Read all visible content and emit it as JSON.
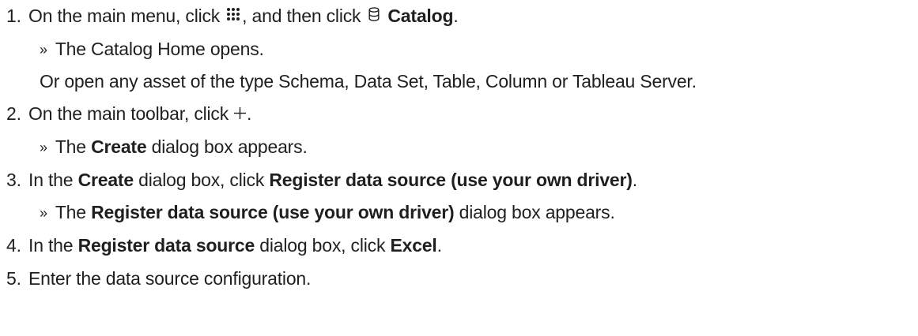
{
  "steps": [
    {
      "number": "1.",
      "text_before_grid": "On the main menu, click",
      "text_after_grid": ", and then click",
      "catalog_label": "Catalog",
      "text_end": ".",
      "result": "The Catalog Home opens.",
      "alternative": "Or open any asset of the type Schema, Data Set, Table, Column or Tableau Server."
    },
    {
      "number": "2.",
      "text_before_plus": "On the main toolbar, click",
      "text_end": ".",
      "result_before": "The",
      "result_bold": "Create",
      "result_after": "dialog box appears."
    },
    {
      "number": "3.",
      "text_before": "In the",
      "bold_1": "Create",
      "text_mid": "dialog box, click",
      "bold_2": "Register data source (use your own driver)",
      "text_end": ".",
      "result_before": "The",
      "result_bold": "Register data source (use your own driver)",
      "result_after": "dialog box appears."
    },
    {
      "number": "4.",
      "text_before": "In the",
      "bold_1": "Register data source",
      "text_mid": "dialog box, click",
      "bold_2": "Excel",
      "text_end": "."
    },
    {
      "number": "5.",
      "text": "Enter the data source configuration."
    }
  ],
  "result_marker": "»",
  "icons": {
    "apps": "grid-menu-icon",
    "catalog": "database-icon",
    "add": "plus-icon"
  }
}
